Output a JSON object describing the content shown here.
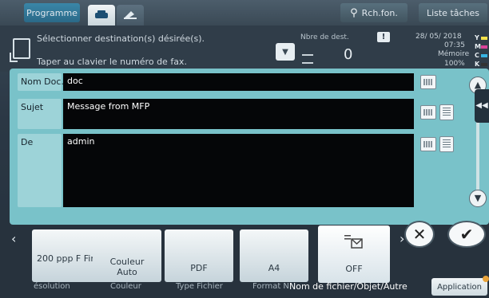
{
  "topbar": {
    "program_label": "Programme",
    "search_label": "Rch.fon.",
    "jobs_label": "Liste tâches",
    "fax_tab_icon": "fax-icon",
    "phone_tab_icon": "phone-icon"
  },
  "status": {
    "instruction_line1": "Sélectionner destination(s) désirée(s).",
    "instruction_line2": "Taper au clavier le numéro de fax.",
    "dest_label": "Nbre de dest.",
    "dest_count": "0",
    "date": "28/ 05/ 2018",
    "time": "07:35",
    "memory_label": "Mémoire",
    "memory_value": "100%",
    "toner": [
      "Y",
      "M",
      "C",
      "K"
    ]
  },
  "dialog": {
    "fields": [
      {
        "label": "Nom Doc.",
        "value": "doc"
      },
      {
        "label": "Sujet",
        "value": "Message from MFP"
      },
      {
        "label": "De",
        "value": "admin"
      }
    ]
  },
  "functions": {
    "tiles": [
      {
        "value": "200 ppp\nF Fin",
        "caption": "ésolution"
      },
      {
        "value": "Couleur\nAuto",
        "caption": "Couleur"
      },
      {
        "value": "PDF",
        "caption": "Type Fichier"
      },
      {
        "value": "A4",
        "caption": "Format N"
      },
      {
        "value": "OFF",
        "caption": "Nom de fichier/Objet/Autre"
      }
    ],
    "application_label": "Application"
  },
  "colors": {
    "dialog_bg": "#79c2c9",
    "field_bg": "#050608",
    "accent": "#2a6988"
  }
}
